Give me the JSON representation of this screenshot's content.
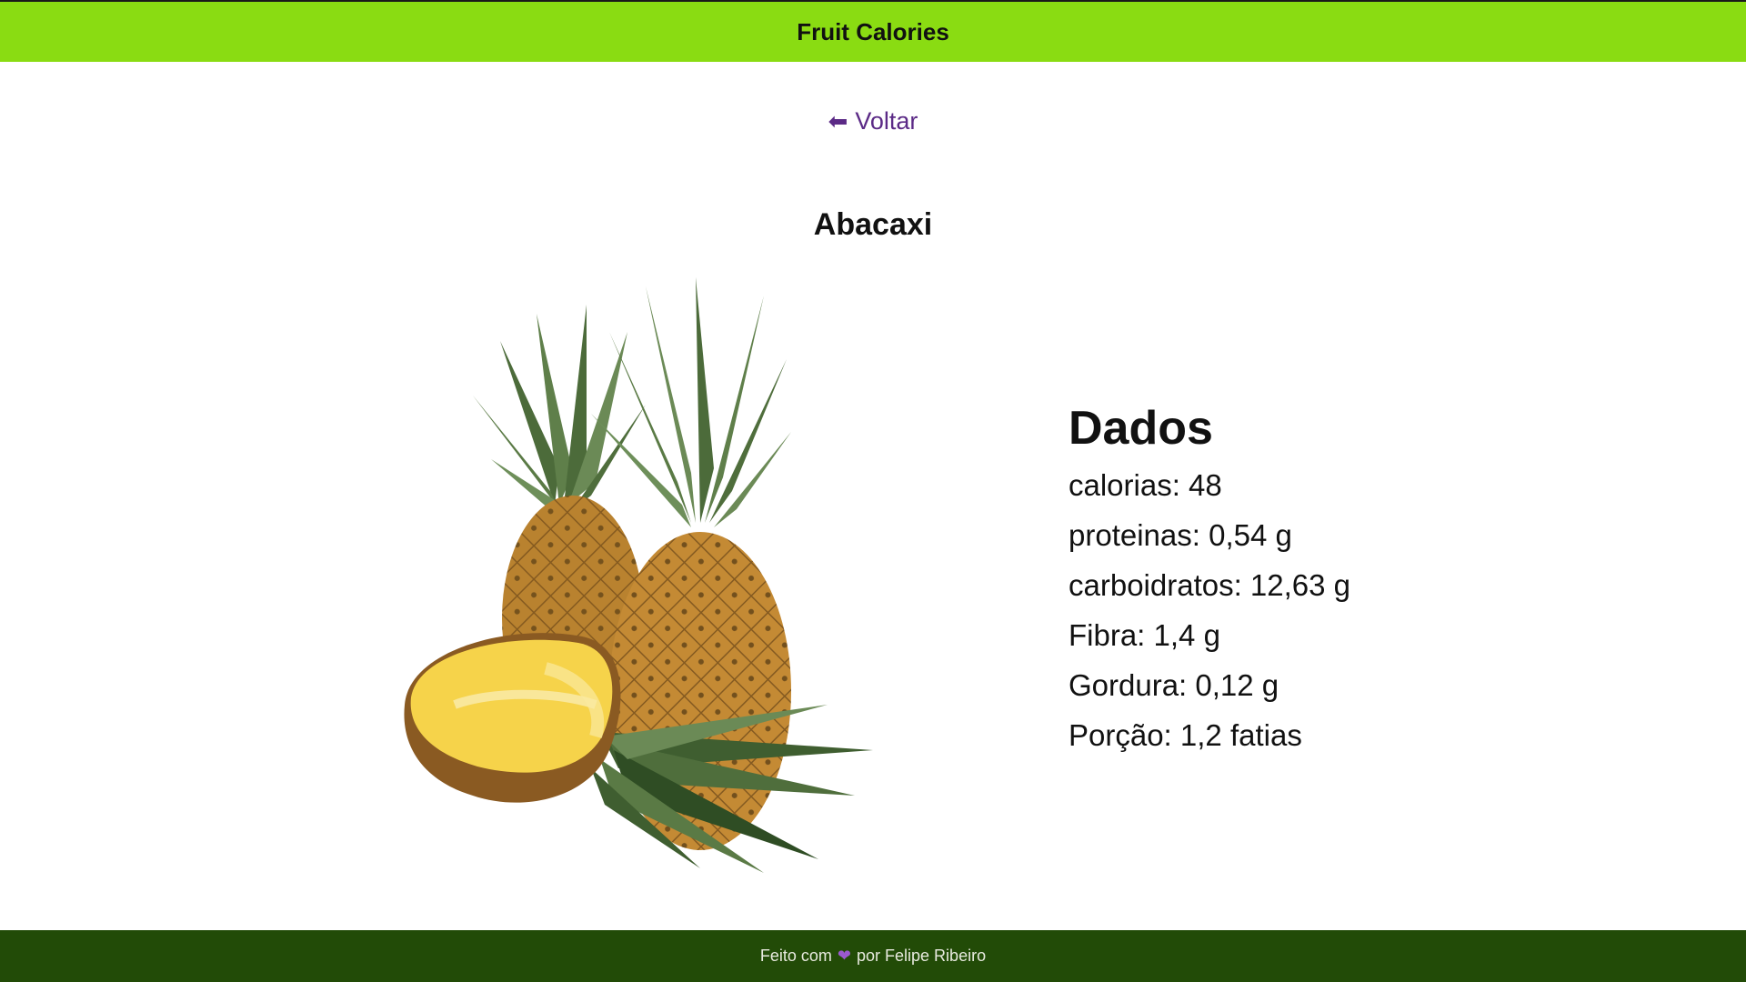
{
  "colors": {
    "header_bg": "#8adc12",
    "footer_bg": "#224b07",
    "link": "#5b2a86",
    "heart": "#9b59d0"
  },
  "header": {
    "title": "Fruit Calories"
  },
  "nav": {
    "back_icon": "arrow-left-icon",
    "back_label": "Voltar"
  },
  "fruit": {
    "name": "Abacaxi",
    "image_icon": "pineapple-image"
  },
  "data": {
    "heading": "Dados",
    "rows": [
      "calorias: 48",
      "proteinas: 0,54 g",
      "carboidratos: 12,63 g",
      "Fibra: 1,4 g",
      "Gordura: 0,12 g",
      "Porção: 1,2 fatias"
    ]
  },
  "footer": {
    "prefix": "Feito com",
    "heart_icon": "heart-icon",
    "suffix": "por Felipe Ribeiro"
  }
}
